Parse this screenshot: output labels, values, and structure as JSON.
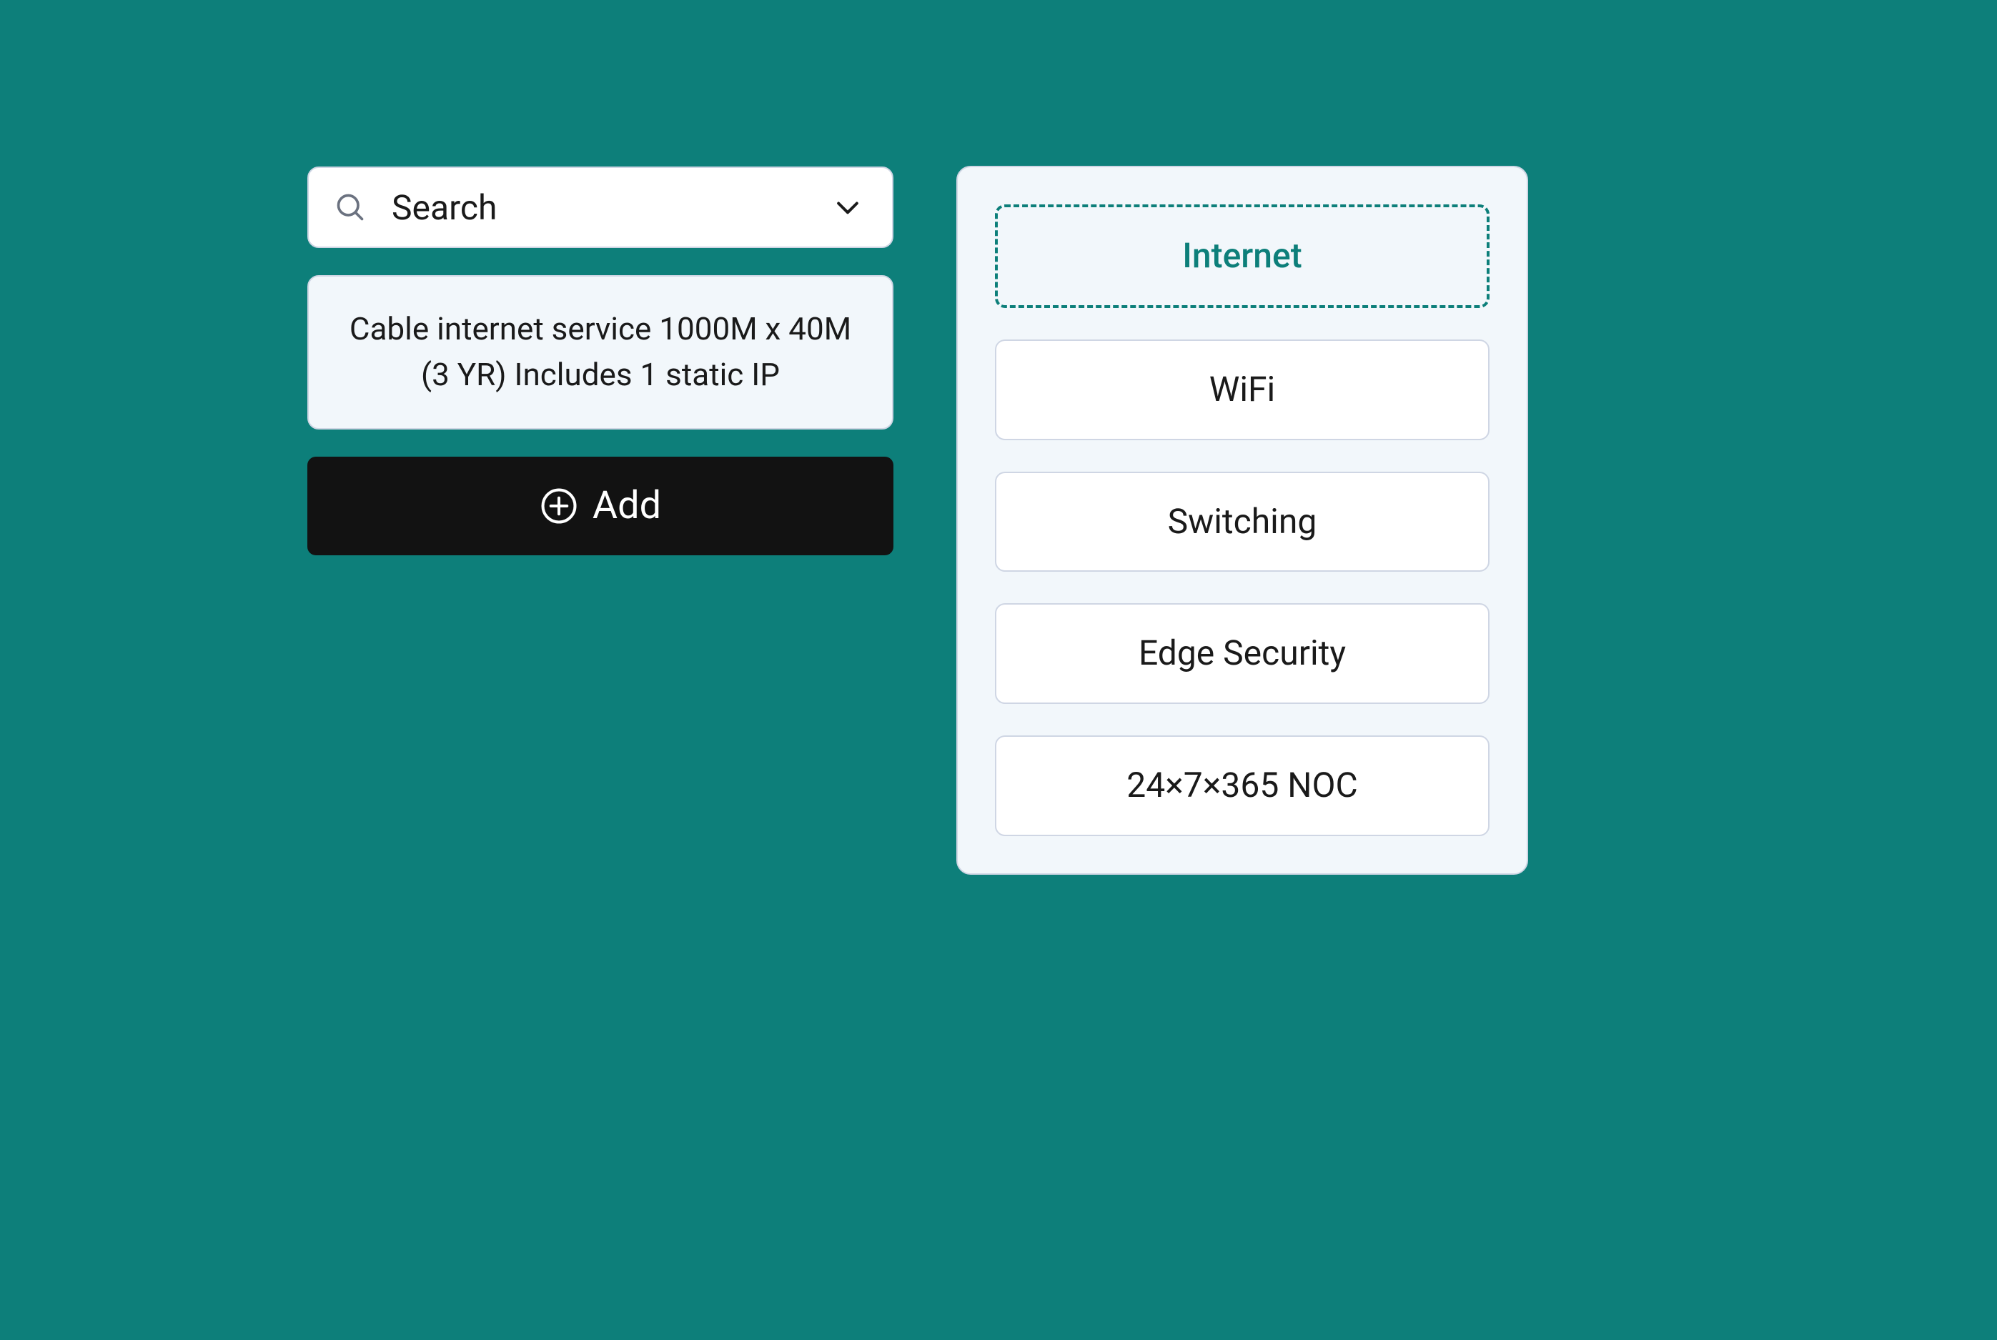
{
  "search": {
    "placeholder": "Search"
  },
  "description": "Cable internet service 1000M x 40M (3 YR) Includes 1 static IP",
  "add_button_label": "Add",
  "categories": [
    {
      "label": "Internet",
      "selected": true
    },
    {
      "label": "WiFi",
      "selected": false
    },
    {
      "label": "Switching",
      "selected": false
    },
    {
      "label": "Edge Security",
      "selected": false
    },
    {
      "label": "24×7×365 NOC",
      "selected": false
    }
  ],
  "colors": {
    "background": "#0d7f7a",
    "panel": "#f2f7fb",
    "border": "#cfd6e4",
    "accent": "#0d7f7a",
    "button": "#121212"
  }
}
